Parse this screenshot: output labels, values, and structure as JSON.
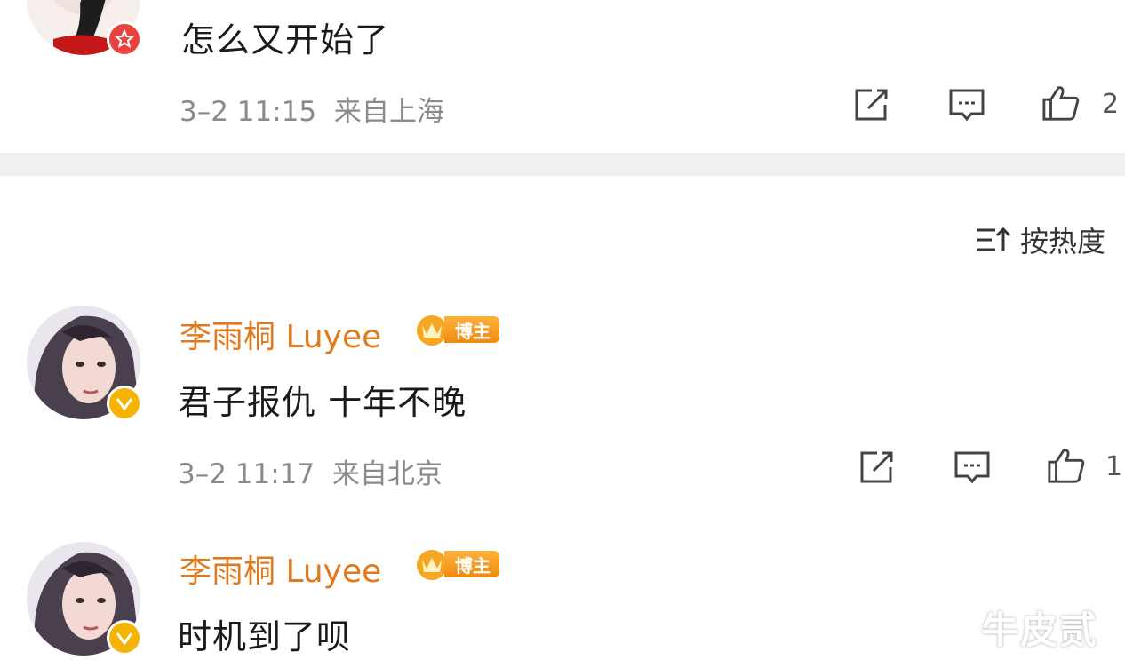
{
  "comments": [
    {
      "text": "怎么又开始了",
      "time": "3–2 11:15",
      "location": "来自上海",
      "likes": "2"
    },
    {
      "username": "李雨桐 Luyee",
      "tag": "博主",
      "text": "君子报仇 十年不晚",
      "time": "3–2 11:17",
      "location": "来自北京",
      "likes": "1"
    },
    {
      "username": "李雨桐 Luyee",
      "tag": "博主",
      "text": "时机到了呗"
    }
  ],
  "sort": {
    "label": "按热度"
  },
  "watermark": "牛皮贰",
  "icons": {
    "share": "share-icon",
    "comment": "comment-icon",
    "like": "thumbs-up-icon",
    "sort": "sort-icon",
    "verified": "verified-badge-icon"
  },
  "colors": {
    "username": "#e07a1f",
    "meta": "#8a8a8a",
    "separator": "#f0f0f2",
    "badge_red": "#e8433f",
    "badge_gold": "#f5b400"
  }
}
